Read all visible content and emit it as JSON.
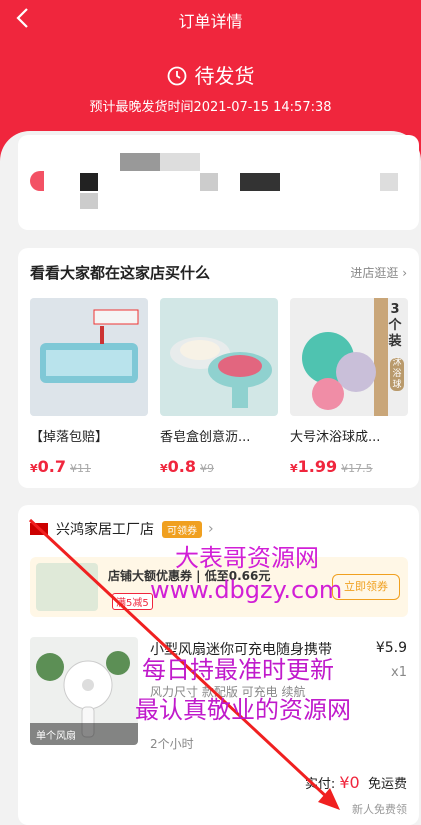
{
  "header": {
    "title": "订单详情",
    "status": "待发货",
    "eta": "预计最晚发货时间2021-07-15 14:57:38"
  },
  "recommend": {
    "title": "看看大家都在这家店买什么",
    "more": "进店逛逛",
    "products": [
      {
        "name": "【掉落包赔】",
        "price": "0.7",
        "orig": "¥11"
      },
      {
        "name": "香皂盒创意沥...",
        "price": "0.8",
        "orig": "¥9"
      },
      {
        "name": "大号沐浴球成...",
        "price": "1.99",
        "orig": "¥17.5"
      }
    ],
    "img3_text": "3个装",
    "img3_tag": "沐浴球"
  },
  "shop": {
    "name": "兴鸿家居工厂店",
    "coupon_tag": "可领券",
    "banner_title": "店铺大额优惠券 | 低至0.66元",
    "banner_tag": "满5减5",
    "banner_btn": "立即领券"
  },
  "item": {
    "name": "小型风扇迷你可充电随身携带",
    "spec": "风力尺寸 款配版 可充电 续航",
    "ship": "2个小时",
    "price": "¥5.9",
    "qty": "x1",
    "img_label": "单个风扇"
  },
  "summary": {
    "paid_label": "实付:",
    "paid_amount": "¥0",
    "freight": "免运费",
    "newuser": "新人免费领"
  },
  "watermark": {
    "line1": "大表哥资源网",
    "line2": "www.dbgzy.com",
    "line3": "每日持最准时更新",
    "line4": "最认真敬业的资源网"
  }
}
